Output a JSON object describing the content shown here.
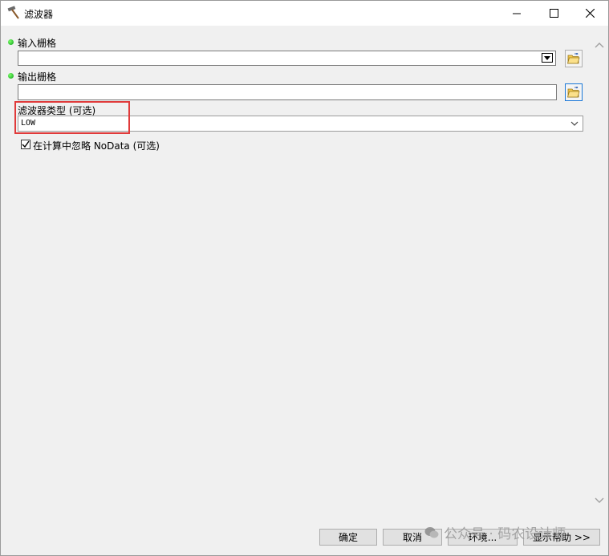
{
  "window": {
    "title": "滤波器",
    "title_icon": "hammer-icon"
  },
  "form": {
    "input_raster_label": "输入栅格",
    "input_raster_value": "",
    "output_raster_label": "输出栅格",
    "output_raster_value": "",
    "filter_type_label": "滤波器类型 (可选)",
    "filter_type_value": "LOW",
    "ignore_nodata_label": "在计算中忽略 NoData (可选)",
    "ignore_nodata_checked": true
  },
  "buttons": {
    "ok": "确定",
    "cancel": "取消",
    "environments": "环境...",
    "show_help": "显示帮助 >>"
  },
  "watermark": "公众号 · 码农设计师",
  "colors": {
    "highlight_box": "#e03a3a",
    "required_dot": "#0a9e16",
    "focus_border": "#1a78d8"
  }
}
